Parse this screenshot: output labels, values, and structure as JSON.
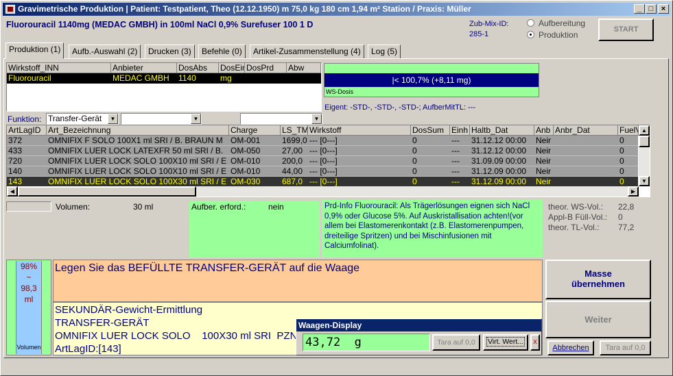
{
  "window": {
    "title": "Gravimetrische Produktion  |  Patient: Testpatient, Theo (12.12.1950) m 75,0 kg  180 cm  1,94 m² Station / Praxis: Müller",
    "minimize": "_",
    "maximize": "□",
    "close": "×"
  },
  "header": {
    "product": "Fluorouracil 1140mg (MEDAC GMBH) in 100ml NaCl 0,9% Surefuser 100 1 D",
    "zub_label": "Zub-Mix-ID:",
    "zub_id": "285-1",
    "radio_aufbereitung": "Aufbereitung",
    "radio_produktion": "Produktion",
    "start_label": "START"
  },
  "tabs": [
    {
      "label": "Produktion (1)"
    },
    {
      "label": "Aufb.-Auswahl (2)"
    },
    {
      "label": "Drucken (3)"
    },
    {
      "label": "Befehle (0)"
    },
    {
      "label": "Artikel-Zusammenstellung (4)"
    },
    {
      "label": "Log (5)"
    }
  ],
  "wirkstoff_table": {
    "headers": [
      "Wirkstoff_INN",
      "Anbieter",
      "DosAbs",
      "DosEin",
      "DosPrd",
      "Abw"
    ],
    "row": [
      "Fluorouracil",
      "MEDAC GMBH",
      "1140",
      "mg",
      "",
      ""
    ]
  },
  "dosis": {
    "value": "|<   100,7%  (+8,11 mg)",
    "label": "WS-Dosis",
    "eigent": "Eigent: -STD-, -STD-, -STD-; AufberMitTL: ---"
  },
  "funktion": {
    "label": "Funktion:",
    "value": "Transfer-Gerät"
  },
  "artikel_table": {
    "headers": [
      "ArtLagID",
      "Art_Bezeichnung",
      "Charge",
      "LS_TM",
      "Wirkstoff",
      "DosSum",
      "Einh",
      "Haltb_Dat",
      "Anb",
      "Anbr_Dat",
      "FuelV"
    ],
    "rows": [
      [
        "372",
        "OMNIFIX F SOLO    100X1 ml SRI  / B. BRAUN M",
        "OM-001",
        "1699,0",
        "--- [0---]",
        "0",
        "---",
        "31.12.12 00:00",
        "Neir",
        "",
        "0"
      ],
      [
        "433",
        "OMNIFIX LUER LOCK LATEXFR   50 ml SRI  / B.",
        "OM-050",
        "27,00",
        "--- [0---]",
        "0",
        "---",
        "31.12.12 00:00",
        "Neir",
        "",
        "0"
      ],
      [
        "720",
        "OMNIFIX LUER LOCK SOLO    100X10 ml SRI  / E",
        "OM-010",
        "200,0",
        "--- [0---]",
        "0",
        "---",
        "31.09.09 00:00",
        "Neir",
        "",
        "0"
      ],
      [
        "140",
        "OMNIFIX LUER LOCK SOLO    100X10 ml SRI  / E",
        "OM-010",
        "44,00",
        "--- [0---]",
        "0",
        "---",
        "31.12.09 00:00",
        "Neir",
        "",
        "0"
      ],
      [
        "143",
        "OMNIFIX LUER LOCK SOLO    100X30 ml SRI  / E",
        "OM-030",
        "687,0",
        "--- [0---]",
        "0",
        "---",
        "31.12.09 00:00",
        "Neir",
        "",
        "0"
      ]
    ]
  },
  "info": {
    "volumen_label": "Volumen:",
    "volumen_value": "30 ml",
    "aufber_label": "Aufber. erford.:",
    "aufber_value": "nein",
    "prd_info": "Prd-Info Fluorouracil: Als Trägerlösungen eignen sich NaCl 0,9% oder Glucose 5%. Auf Auskristallisation achten!(vor allem bei Elastomerenkontakt (z.B. Elastomerenpumpen, dreiteilige Spritzen) und bei Mischinfusionen mit Calciumfolinat).",
    "ws_vol_label": "theor. WS-Vol.:",
    "ws_vol_value": "22,8",
    "applb_label": "Appl-B Füll-Vol.:",
    "applb_value": "0",
    "tl_vol_label": "theor. TL-Vol.:",
    "tl_vol_value": "77,2"
  },
  "volumen_bar": {
    "line1": "98%",
    "line2": "~",
    "line3": "98,3",
    "line4": "ml",
    "label": "Volumen"
  },
  "instruction": "Legen Sie das BEFÜLLTE TRANSFER-GERÄT auf die Waage",
  "detail_lines": [
    "SEKUNDÄR-Gewicht-Ermittlung",
    "TRANSFER-GERÄT",
    "OMNIFIX LUER LOCK SOLO    100X30 ml SRI  PZN",
    "ArtLagID:[143]"
  ],
  "buttons": {
    "masse_line1": "Masse",
    "masse_line2": "übernehmen",
    "weiter": "Weiter",
    "abbrechen": "Abbrechen",
    "tara": "Tara auf 0,0"
  },
  "waage": {
    "title": "Waagen-Display",
    "value": "43,72  g",
    "tara": "Tara auf 0,0",
    "virt": "Virt. Wert...",
    "close": "x"
  },
  "colors": {
    "title_blue": "#0a246a",
    "green": "#99ff99",
    "navy": "#000080",
    "peach": "#ffcc99",
    "cream": "#ffffcc",
    "light_blue": "#99ccff",
    "dark_red": "#800000"
  }
}
